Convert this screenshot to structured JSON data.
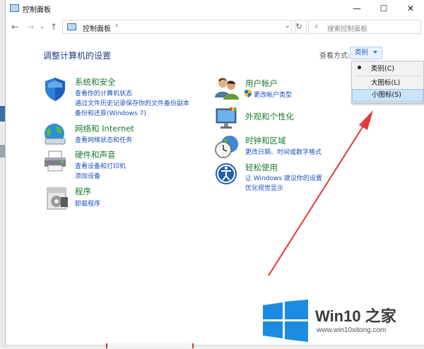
{
  "window": {
    "title": "控制面板"
  },
  "titlebar": {
    "minimize": "—",
    "maximize": "☐",
    "close": "✕"
  },
  "address": {
    "back": "←",
    "forward": "→",
    "up": "↑",
    "path": "控制面板",
    "chevron": "›",
    "dropdown": "⌄",
    "refresh": "↻"
  },
  "search": {
    "placeholder": "搜索控制面板",
    "icon": "⌕"
  },
  "main": {
    "title": "调整计算机的设置"
  },
  "view": {
    "label": "查看方式:",
    "value": "类别"
  },
  "menu": {
    "items": [
      "类别(C)",
      "大图标(L)",
      "小图标(S)"
    ]
  },
  "left_categories": [
    {
      "title": "系统和安全",
      "links": [
        "查看你的计算机状态",
        "通过文件历史记录保存你的文件备份副本",
        "备份和还原(Windows 7)"
      ]
    },
    {
      "title": "网络和 Internet",
      "links": [
        "查看网络状态和任务"
      ]
    },
    {
      "title": "硬件和声音",
      "links": [
        "查看设备和打印机",
        "添加设备"
      ]
    },
    {
      "title": "程序",
      "links": [
        "卸载程序"
      ]
    }
  ],
  "right_categories": [
    {
      "title": "用户帐户",
      "links": [
        "更改帐户类型"
      ]
    },
    {
      "title": "外观和个性化",
      "links": []
    },
    {
      "title": "时钟和区域",
      "links": [
        "更改日期、时间或数字格式"
      ]
    },
    {
      "title": "轻松使用",
      "links": [
        "让 Windows 建议你的设置",
        "优化视觉显示"
      ]
    }
  ],
  "watermark": {
    "text": "Win10 之家",
    "url": "www.win10xitong.com"
  },
  "colors": {
    "accent_blue": "#1b4fc2",
    "category_green": "#1a7a2e",
    "arrow_red": "#e03a3a",
    "logo_blue": "#1c8be0"
  }
}
